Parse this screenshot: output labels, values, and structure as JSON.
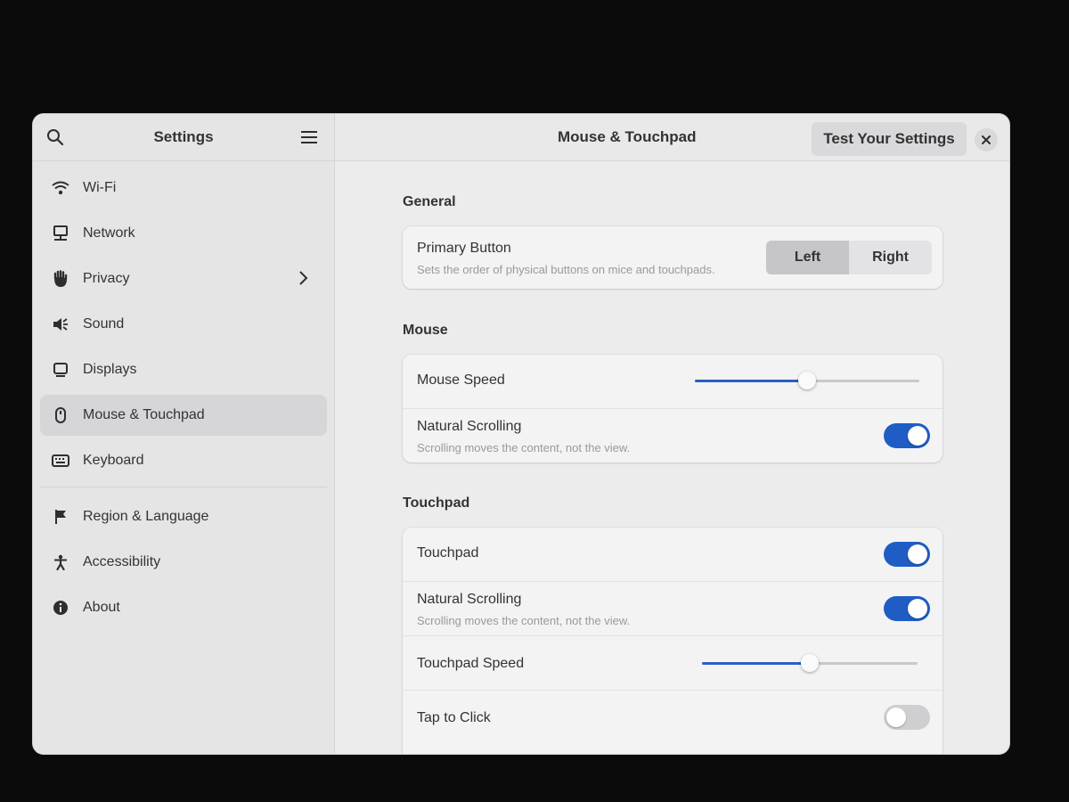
{
  "sidebar": {
    "title": "Settings",
    "items": [
      {
        "label": "Wi-Fi",
        "icon": "wifi-icon"
      },
      {
        "label": "Network",
        "icon": "network-icon"
      },
      {
        "label": "Privacy",
        "icon": "hand-icon"
      },
      {
        "label": "Sound",
        "icon": "speaker-icon"
      },
      {
        "label": "Displays",
        "icon": "display-icon"
      },
      {
        "label": "Mouse & Touchpad",
        "icon": "mouse-icon"
      },
      {
        "label": "Keyboard",
        "icon": "keyboard-icon"
      },
      {
        "label": "Region & Language",
        "icon": "flag-icon"
      },
      {
        "label": "Accessibility",
        "icon": "accessibility-icon"
      },
      {
        "label": "About",
        "icon": "info-icon"
      }
    ],
    "active": "Mouse & Touchpad"
  },
  "header": {
    "title": "Mouse & Touchpad",
    "test_button": "Test Your Settings"
  },
  "general": {
    "title": "General",
    "primary_button": {
      "label": "Primary Button",
      "subtitle": "Sets the order of physical buttons on mice and touchpads.",
      "options": [
        "Left",
        "Right"
      ],
      "selected": "Left"
    }
  },
  "mouse": {
    "title": "Mouse",
    "speed_label": "Mouse Speed",
    "speed_value": 0.5,
    "natural_scrolling": {
      "label": "Natural Scrolling",
      "subtitle": "Scrolling moves the content, not the view.",
      "on": true
    }
  },
  "touchpad": {
    "title": "Touchpad",
    "touchpad_label": "Touchpad",
    "touchpad_on": true,
    "natural_scrolling": {
      "label": "Natural Scrolling",
      "subtitle": "Scrolling moves the content, not the view.",
      "on": true
    },
    "speed_label": "Touchpad Speed",
    "speed_value": 0.5,
    "tap_label": "Tap to Click",
    "tap_on": false
  },
  "colors": {
    "accent": "#1f5dc4"
  }
}
